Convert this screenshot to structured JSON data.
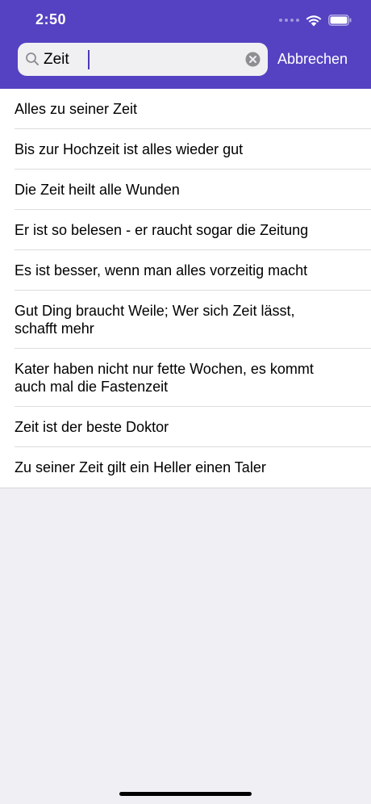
{
  "status_bar": {
    "time": "2:50"
  },
  "search": {
    "value": "Zeit",
    "cancel_label": "Abbrechen"
  },
  "results": [
    {
      "text": "Alles zu seiner Zeit",
      "lines": 1
    },
    {
      "text": "Bis zur Hochzeit ist alles wieder gut",
      "lines": 1
    },
    {
      "text": "Die Zeit heilt alle Wunden",
      "lines": 1
    },
    {
      "text": "Er ist so belesen - er raucht sogar die Zeitung",
      "lines": 1
    },
    {
      "text": "Es ist besser, wenn man alles vorzeitig macht",
      "lines": 1
    },
    {
      "text": "Gut Ding braucht Weile; Wer sich Zeit lässt, schafft mehr",
      "lines": 2
    },
    {
      "text": "Kater haben nicht nur fette Wochen, es kommt auch mal die Fastenzeit",
      "lines": 2
    },
    {
      "text": "Zeit ist der beste Doktor",
      "lines": 1
    },
    {
      "text": "Zu seiner Zeit gilt ein Heller einen Taler",
      "lines": 1
    }
  ],
  "colors": {
    "nav_bar": "#5442c2",
    "background": "#efeff4"
  }
}
